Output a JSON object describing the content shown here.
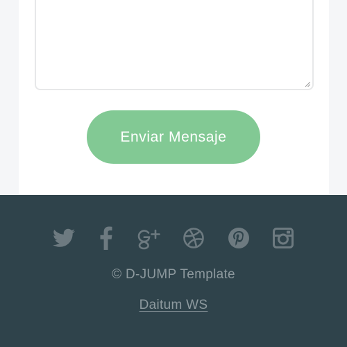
{
  "form": {
    "send_label": "Enviar Mensaje",
    "accent_color": "#82c994"
  },
  "footer": {
    "background_color": "#2f434b",
    "social_icons": [
      "twitter-icon",
      "facebook-icon",
      "google-plus-icon",
      "dribbble-icon",
      "pinterest-icon",
      "instagram-icon"
    ],
    "copyright": "© D-JUMP Template",
    "credit_link": "Daitum WS"
  }
}
